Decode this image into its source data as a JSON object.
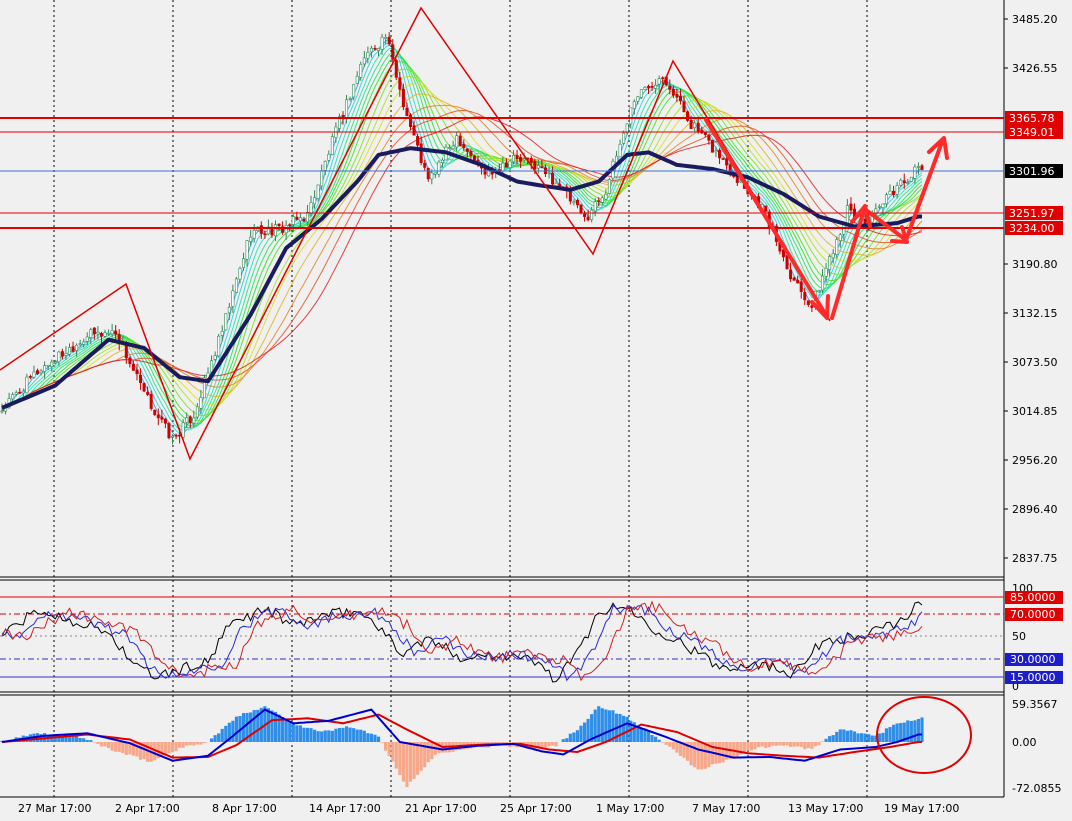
{
  "colors": {
    "background": "#f0f0f0",
    "grid": "#000000",
    "candle_up": "#2e8b57",
    "candle_down": "#cc0000",
    "baseline": "#1a1a5e",
    "level_line": "#e00000",
    "annotation": "#ff2a2a",
    "current_price_line": "#3b6fd1",
    "histogram_positive": "#2f8fe8",
    "histogram_negative": "#f7a88a",
    "macd_main": "#0000cc",
    "macd_signal": "#dd0000"
  },
  "price_axis": {
    "ticks": [
      "3485.20",
      "3426.55",
      "3190.80",
      "3132.15",
      "3073.50",
      "3014.85",
      "2956.20",
      "2896.40",
      "2837.75"
    ],
    "current_price_tag": "3301.96",
    "level_tags": [
      "3365.78",
      "3349.01",
      "3251.97",
      "3234.00"
    ],
    "range": [
      2806,
      3505
    ]
  },
  "time_axis": {
    "labels": [
      "27 Mar 17:00",
      "2 Apr 17:00",
      "8 Apr 17:00",
      "14 Apr 17:00",
      "21 Apr 17:00",
      "25 Apr 17:00",
      "1 May 17:00",
      "7 May 17:00",
      "13 May 17:00",
      "19 May 17:00"
    ]
  },
  "oscillator": {
    "ticks": [
      "100",
      "50",
      "0"
    ],
    "level_tags": [
      "85.0000",
      "70.0000",
      "30.0000",
      "15.0000"
    ],
    "range": [
      0,
      100
    ]
  },
  "macd": {
    "ticks": [
      "59.3567",
      "0.00",
      "-72.0855"
    ],
    "range": [
      -72.0855,
      59.3567
    ]
  },
  "chart_data": {
    "type": "candlestick",
    "title": "",
    "price_anchors": [
      [
        0,
        3016
      ],
      [
        10,
        3062
      ],
      [
        24,
        3105
      ],
      [
        32,
        3110
      ],
      [
        40,
        3035
      ],
      [
        48,
        2980
      ],
      [
        54,
        3010
      ],
      [
        62,
        3110
      ],
      [
        70,
        3230
      ],
      [
        78,
        3232
      ],
      [
        86,
        3250
      ],
      [
        94,
        3350
      ],
      [
        102,
        3440
      ],
      [
        108,
        3465
      ],
      [
        114,
        3370
      ],
      [
        120,
        3290
      ],
      [
        128,
        3345
      ],
      [
        136,
        3300
      ],
      [
        144,
        3318
      ],
      [
        150,
        3310
      ],
      [
        156,
        3290
      ],
      [
        164,
        3245
      ],
      [
        170,
        3280
      ],
      [
        178,
        3390
      ],
      [
        186,
        3420
      ],
      [
        194,
        3360
      ],
      [
        200,
        3330
      ],
      [
        206,
        3300
      ],
      [
        214,
        3260
      ],
      [
        222,
        3180
      ],
      [
        228,
        3140
      ],
      [
        234,
        3210
      ],
      [
        238,
        3255
      ],
      [
        244,
        3240
      ],
      [
        252,
        3285
      ],
      [
        258,
        3305
      ]
    ],
    "baseline_anchors": [
      [
        0,
        3018
      ],
      [
        15,
        3045
      ],
      [
        30,
        3100
      ],
      [
        40,
        3090
      ],
      [
        50,
        3055
      ],
      [
        58,
        3050
      ],
      [
        70,
        3130
      ],
      [
        80,
        3210
      ],
      [
        90,
        3245
      ],
      [
        100,
        3290
      ],
      [
        106,
        3322
      ],
      [
        115,
        3330
      ],
      [
        125,
        3325
      ],
      [
        135,
        3310
      ],
      [
        145,
        3290
      ],
      [
        152,
        3285
      ],
      [
        160,
        3280
      ],
      [
        168,
        3290
      ],
      [
        176,
        3322
      ],
      [
        182,
        3325
      ],
      [
        190,
        3310
      ],
      [
        200,
        3305
      ],
      [
        210,
        3295
      ],
      [
        220,
        3275
      ],
      [
        230,
        3248
      ],
      [
        240,
        3236
      ],
      [
        252,
        3240
      ],
      [
        258,
        3248
      ]
    ],
    "oscillator_anchors": [
      [
        0,
        60
      ],
      [
        10,
        85
      ],
      [
        20,
        75
      ],
      [
        30,
        62
      ],
      [
        38,
        25
      ],
      [
        44,
        15
      ],
      [
        52,
        25
      ],
      [
        58,
        30
      ],
      [
        64,
        70
      ],
      [
        74,
        88
      ],
      [
        82,
        70
      ],
      [
        90,
        80
      ],
      [
        100,
        85
      ],
      [
        106,
        70
      ],
      [
        112,
        40
      ],
      [
        120,
        55
      ],
      [
        130,
        35
      ],
      [
        140,
        40
      ],
      [
        150,
        32
      ],
      [
        156,
        12
      ],
      [
        162,
        40
      ],
      [
        168,
        85
      ],
      [
        176,
        90
      ],
      [
        182,
        70
      ],
      [
        192,
        50
      ],
      [
        202,
        25
      ],
      [
        212,
        30
      ],
      [
        222,
        20
      ],
      [
        232,
        55
      ],
      [
        242,
        58
      ],
      [
        252,
        72
      ],
      [
        258,
        92
      ]
    ],
    "macd_histogram_anchors": [
      [
        0,
        0
      ],
      [
        10,
        14
      ],
      [
        22,
        8
      ],
      [
        32,
        -15
      ],
      [
        42,
        -32
      ],
      [
        50,
        -10
      ],
      [
        58,
        0
      ],
      [
        66,
        40
      ],
      [
        74,
        58
      ],
      [
        82,
        30
      ],
      [
        90,
        16
      ],
      [
        98,
        25
      ],
      [
        106,
        8
      ],
      [
        114,
        -72
      ],
      [
        122,
        -20
      ],
      [
        130,
        -10
      ],
      [
        140,
        -6
      ],
      [
        150,
        -10
      ],
      [
        156,
        -5
      ],
      [
        162,
        20
      ],
      [
        168,
        58
      ],
      [
        176,
        40
      ],
      [
        186,
        0
      ],
      [
        196,
        -45
      ],
      [
        204,
        -30
      ],
      [
        212,
        -10
      ],
      [
        220,
        -5
      ],
      [
        228,
        -12
      ],
      [
        236,
        20
      ],
      [
        246,
        10
      ],
      [
        252,
        30
      ],
      [
        258,
        38
      ]
    ],
    "macd_line_anchors": [
      [
        0,
        0
      ],
      [
        12,
        10
      ],
      [
        24,
        14
      ],
      [
        36,
        -2
      ],
      [
        48,
        -30
      ],
      [
        58,
        -22
      ],
      [
        64,
        5
      ],
      [
        74,
        52
      ],
      [
        82,
        30
      ],
      [
        92,
        34
      ],
      [
        104,
        52
      ],
      [
        112,
        0
      ],
      [
        124,
        -12
      ],
      [
        134,
        -6
      ],
      [
        144,
        -3
      ],
      [
        152,
        -15
      ],
      [
        158,
        -20
      ],
      [
        166,
        5
      ],
      [
        176,
        30
      ],
      [
        186,
        10
      ],
      [
        196,
        -12
      ],
      [
        206,
        -25
      ],
      [
        216,
        -24
      ],
      [
        226,
        -30
      ],
      [
        236,
        -12
      ],
      [
        246,
        -8
      ],
      [
        252,
        0
      ],
      [
        258,
        12
      ]
    ],
    "signal_line_anchors": [
      [
        0,
        0
      ],
      [
        12,
        6
      ],
      [
        24,
        12
      ],
      [
        36,
        4
      ],
      [
        48,
        -25
      ],
      [
        58,
        -24
      ],
      [
        66,
        -5
      ],
      [
        76,
        35
      ],
      [
        86,
        38
      ],
      [
        96,
        30
      ],
      [
        106,
        44
      ],
      [
        114,
        20
      ],
      [
        124,
        -8
      ],
      [
        136,
        -4
      ],
      [
        146,
        -3
      ],
      [
        154,
        -12
      ],
      [
        162,
        -16
      ],
      [
        170,
        0
      ],
      [
        180,
        28
      ],
      [
        190,
        16
      ],
      [
        200,
        -8
      ],
      [
        210,
        -18
      ],
      [
        220,
        -22
      ],
      [
        230,
        -25
      ],
      [
        240,
        -16
      ],
      [
        250,
        -8
      ],
      [
        258,
        0
      ]
    ]
  }
}
